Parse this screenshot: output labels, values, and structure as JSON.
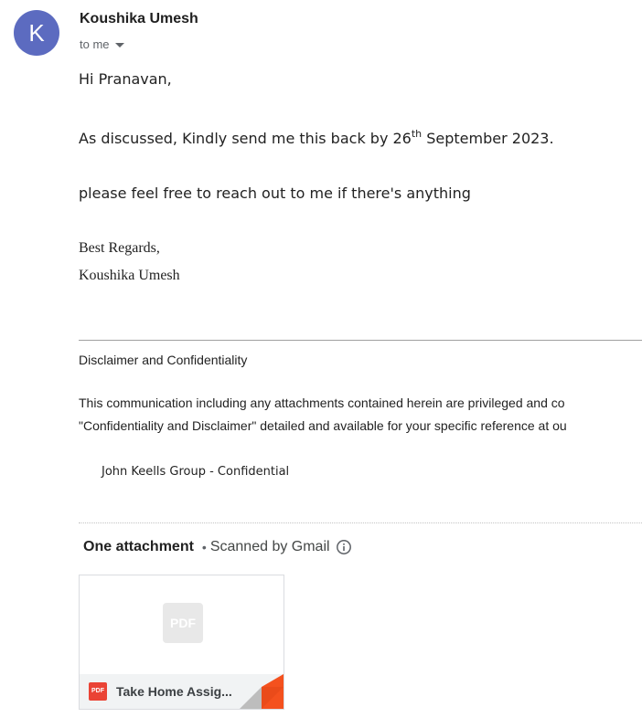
{
  "sender": {
    "avatar_letter": "K",
    "avatar_color": "#5c6bc0",
    "name": "Koushika Umesh",
    "recipient_label": "to me"
  },
  "body": {
    "greeting": "Hi Pranavan,",
    "line1_pre": "As discussed, Kindly send me this back by 26",
    "line1_sup": "th",
    "line1_post": " September 2023.",
    "line2": "please feel free to reach out to me if there's anything",
    "signoff": "Best Regards,",
    "signature_name": "Koushika Umesh"
  },
  "disclaimer": {
    "title": "Disclaimer and Confidentiality",
    "line1": "This communication including any attachments contained herein are privileged and co",
    "line2": "\"Confidentiality and Disclaimer\" detailed and available for your specific reference at ou",
    "classification": "John Keells Group - Confidential"
  },
  "attachments": {
    "count_label": "One attachment",
    "separator": "•",
    "scan_label": "Scanned by Gmail",
    "info_icon": "info-icon",
    "items": [
      {
        "preview_label": "PDF",
        "type_label": "PDF",
        "file_name": "Take Home Assig...",
        "type_color": "#ea4335"
      }
    ]
  }
}
